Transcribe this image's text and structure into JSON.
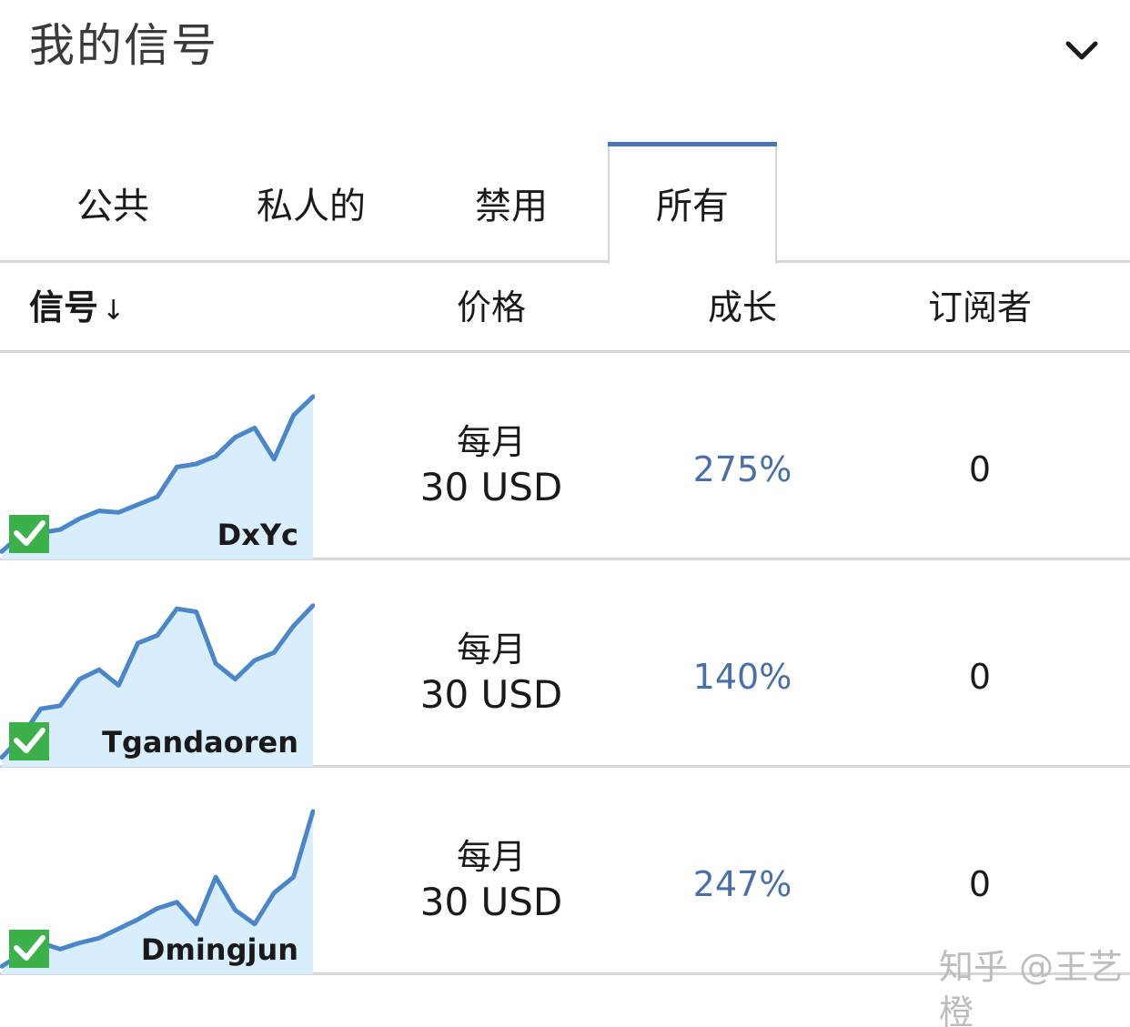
{
  "header": {
    "title": "我的信号",
    "collapse_icon": "chevron-down-icon"
  },
  "tabs": [
    {
      "label": "公共",
      "active": false
    },
    {
      "label": "私人的",
      "active": false
    },
    {
      "label": "禁用",
      "active": false
    },
    {
      "label": "所有",
      "active": true
    }
  ],
  "columns": {
    "signal": "信号",
    "sort_indicator": "↓",
    "price": "价格",
    "growth": "成长",
    "subscribers": "订阅者"
  },
  "colors": {
    "accent": "#4a76b8",
    "growth_text": "#4a6fa8",
    "spark_line": "#4a86c8",
    "spark_fill": "#d9eefc",
    "check_green": "#3cb04a",
    "divider": "#d6d6d6"
  },
  "signals": [
    {
      "name": "DxYc",
      "price_period": "每月",
      "price_amount": "30 USD",
      "growth": "275%",
      "subscribers": "0",
      "verified_icon": "check-badge-icon",
      "sparkline": [
        1,
        12,
        13,
        15,
        22,
        27,
        26,
        31,
        36,
        55,
        57,
        62,
        74,
        80,
        60,
        88,
        100
      ]
    },
    {
      "name": "Tgandaoren",
      "price_period": "每月",
      "price_amount": "30 USD",
      "growth": "140%",
      "subscribers": "0",
      "verified_icon": "check-badge-icon",
      "sparkline": [
        2,
        15,
        33,
        35,
        52,
        58,
        48,
        75,
        80,
        97,
        95,
        62,
        52,
        64,
        69,
        86,
        99
      ]
    },
    {
      "name": "Dmingjun",
      "price_period": "每月",
      "price_amount": "30 USD",
      "growth": "247%",
      "subscribers": "0",
      "verified_icon": "check-badge-icon",
      "sparkline": [
        1,
        9,
        16,
        12,
        16,
        19,
        25,
        31,
        38,
        42,
        28,
        58,
        37,
        28,
        48,
        58,
        100
      ]
    }
  ],
  "watermark": "知乎 @王艺橙"
}
